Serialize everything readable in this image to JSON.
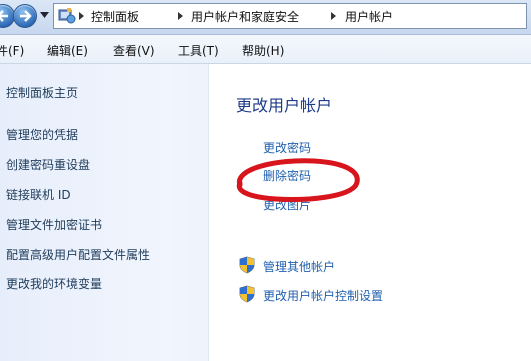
{
  "address_bar": {
    "breadcrumbs": [
      "控制面板",
      "用户帐户和家庭安全",
      "用户帐户"
    ]
  },
  "menu": {
    "items": [
      "件(F)",
      "编辑(E)",
      "查看(V)",
      "工具(T)",
      "帮助(H)"
    ]
  },
  "sidebar": {
    "items": [
      {
        "label": "控制面板主页"
      },
      {
        "label": "管理您的凭据"
      },
      {
        "label": "创建密码重设盘"
      },
      {
        "label": "链接联机 ID"
      },
      {
        "label": "管理文件加密证书"
      },
      {
        "label": "配置高级用户配置文件属性"
      },
      {
        "label": "更改我的环境变量"
      }
    ]
  },
  "main": {
    "title": "更改用户帐户",
    "links": [
      {
        "label": "更改密码"
      },
      {
        "label": "删除密码"
      },
      {
        "label": "更改图片"
      }
    ],
    "shield_links": [
      {
        "label": "管理其他帐户",
        "icon": "uac-shield-icon"
      },
      {
        "label": "更改用户帐户控制设置",
        "icon": "uac-shield-icon"
      }
    ]
  },
  "colors": {
    "link": "#1f5fae",
    "title": "#1e3a8a",
    "annotation": "#d8141c"
  }
}
